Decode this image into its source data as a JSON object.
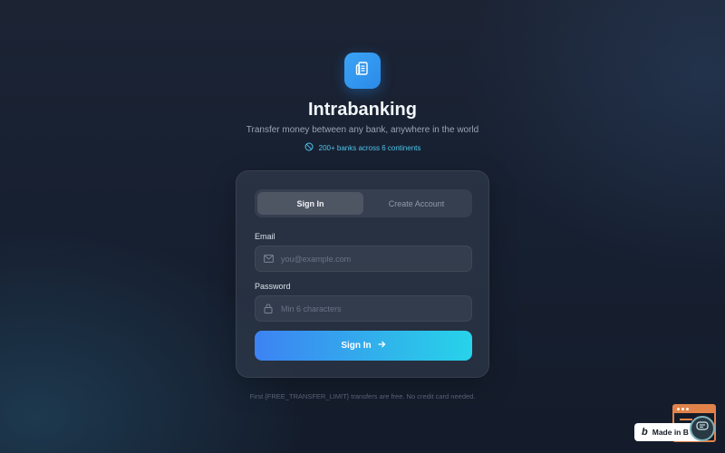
{
  "app": {
    "name": "Intrabanking",
    "tagline": "Transfer money between any bank, anywhere in the world",
    "badge_text": "200+ banks across 6 continents",
    "logo_icon": "document-icon",
    "badge_icon": "globe-slash-icon"
  },
  "auth": {
    "tabs": [
      {
        "label": "Sign In",
        "active": true
      },
      {
        "label": "Create Account",
        "active": false
      }
    ],
    "email": {
      "label": "Email",
      "value": "",
      "placeholder": "you@example.com",
      "icon": "mail-icon"
    },
    "password": {
      "label": "Password",
      "value": "",
      "placeholder": "Min 6 characters",
      "icon": "lock-icon"
    },
    "submit_label": "Sign In",
    "submit_icon": "arrow-right-icon"
  },
  "footnote": "First {FREE_TRANSFER_LIMIT} transfers are free. No credit card needed.",
  "made_in_badge": {
    "logo_char": "b",
    "text": "Made in B"
  },
  "colors": {
    "accent_start": "#3d82f3",
    "accent_end": "#27d3ea",
    "badge_text": "#4cc4ec",
    "logo_bg": "#3ba4f5"
  }
}
